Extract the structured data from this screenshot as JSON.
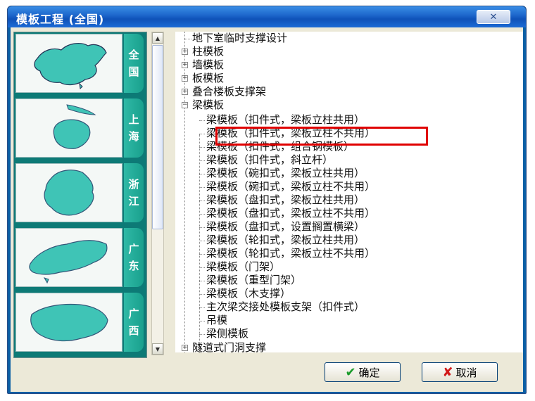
{
  "window": {
    "title": "模板工程 (全国)",
    "close_glyph": "✕"
  },
  "regions": [
    {
      "name": "全国",
      "chars": [
        "全",
        "国"
      ]
    },
    {
      "name": "上海",
      "chars": [
        "上",
        "海"
      ]
    },
    {
      "name": "浙江",
      "chars": [
        "浙",
        "江"
      ]
    },
    {
      "name": "广东",
      "chars": [
        "广",
        "东"
      ]
    },
    {
      "name": "广西",
      "chars": [
        "广",
        "西"
      ]
    }
  ],
  "scrollbar": {
    "up": "▲",
    "down": "▼"
  },
  "tree": {
    "items": [
      {
        "label": "地下室临时支撑设计",
        "level": 0,
        "expander": ""
      },
      {
        "label": "柱模板",
        "level": 0,
        "expander": "+"
      },
      {
        "label": "墙模板",
        "level": 0,
        "expander": "+"
      },
      {
        "label": "板模板",
        "level": 0,
        "expander": "+"
      },
      {
        "label": "叠合楼板支撑架",
        "level": 0,
        "expander": "+"
      },
      {
        "label": "梁模板",
        "level": 0,
        "expander": "−"
      },
      {
        "label": "梁模板（扣件式，梁板立柱共用）",
        "level": 1
      },
      {
        "label": "梁模板（扣件式，梁板立柱不共用）",
        "level": 1
      },
      {
        "label": "梁模板（扣件式，组合钢模板）",
        "level": 1
      },
      {
        "label": "梁模板（扣件式，斜立杆）",
        "level": 1
      },
      {
        "label": "梁模板（碗扣式，梁板立柱共用）",
        "level": 1
      },
      {
        "label": "梁模板（碗扣式，梁板立柱不共用）",
        "level": 1
      },
      {
        "label": "梁模板（盘扣式，梁板立柱共用）",
        "level": 1
      },
      {
        "label": "梁模板（盘扣式，梁板立柱不共用）",
        "level": 1
      },
      {
        "label": "梁模板（盘扣式，设置搁置横梁）",
        "level": 1
      },
      {
        "label": "梁模板（轮扣式，梁板立柱共用）",
        "level": 1
      },
      {
        "label": "梁模板（轮扣式，梁板立柱不共用）",
        "level": 1
      },
      {
        "label": "梁模板（门架）",
        "level": 1
      },
      {
        "label": "梁模板（重型门架）",
        "level": 1
      },
      {
        "label": "梁模板（木支撑）",
        "level": 1
      },
      {
        "label": "主次梁交接处模板支架（扣件式）",
        "level": 1
      },
      {
        "label": "吊模",
        "level": 1
      },
      {
        "label": "梁侧模板",
        "level": 1
      },
      {
        "label": "隧道式门洞支撑",
        "level": 0,
        "expander": "+"
      }
    ]
  },
  "buttons": {
    "ok": {
      "label": "确定",
      "icon": "✔",
      "icon_color": "#1a9b2a"
    },
    "cancel": {
      "label": "取消",
      "icon": "✘",
      "icon_color": "#d11919"
    }
  },
  "colors": {
    "highlight": "#e00000",
    "map_fill": "#3fc4b6",
    "tab": "#19a08d"
  }
}
